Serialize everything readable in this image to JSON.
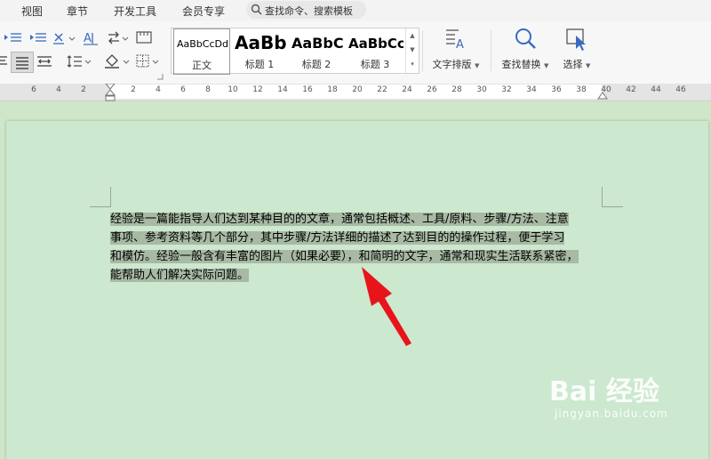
{
  "menubar": {
    "items": [
      "视图",
      "章节",
      "开发工具",
      "会员专享"
    ],
    "search_placeholder": "查找命令、搜索模板"
  },
  "ribbon": {
    "styles": [
      {
        "sample": "AaBbCcDd",
        "name": "正文"
      },
      {
        "sample": "AaBb",
        "name": "标题 1"
      },
      {
        "sample": "AaBbC",
        "name": "标题 2"
      },
      {
        "sample": "AaBbCc",
        "name": "标题 3"
      }
    ],
    "text_layout_label": "文字排版",
    "find_replace_label": "查找替换",
    "select_label": "选择"
  },
  "ruler": {
    "labels": [
      "6",
      "4",
      "2",
      "2",
      "4",
      "6",
      "8",
      "10",
      "12",
      "14",
      "16",
      "18",
      "20",
      "22",
      "24",
      "26",
      "28",
      "30",
      "32",
      "34",
      "36",
      "38",
      "40",
      "42",
      "44",
      "46"
    ]
  },
  "document": {
    "lines": [
      "经验是一篇能指导人们达到某种目的的文章，通常包括概述、工具/原料、步骤/方法、注意",
      "事项、参考资料等几个部分，其中步骤/方法详细的描述了达到目的的操作过程，便于学习",
      "和模仿。经验一般含有丰富的图片（如果必要），和简明的文字，通常和现实生活联系紧密，",
      "能帮助人们解决实际问题。"
    ]
  },
  "watermark": {
    "brand": "Bai 经验",
    "url": "jingyan.baidu.com"
  },
  "colors": {
    "page_bg": "#cce8cf",
    "selection": "#a8baa4",
    "arrow": "#e8141c"
  }
}
